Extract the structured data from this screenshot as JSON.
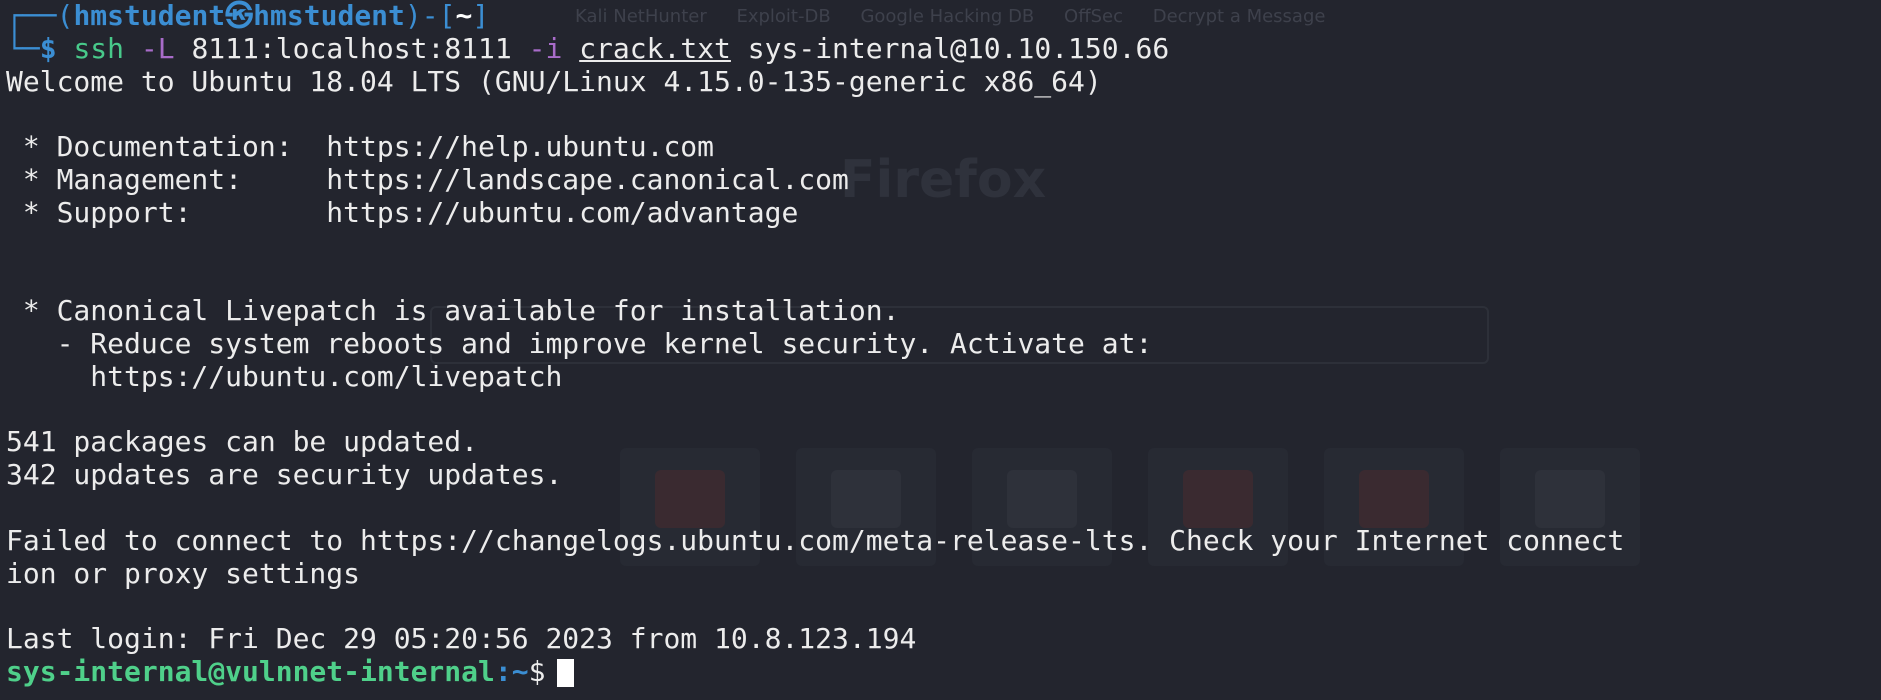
{
  "prompt": {
    "corner_top": "┌──(",
    "user": "hmstudent",
    "at_symbol": "㉿",
    "host": "hmstudent",
    "mid": ")-[",
    "dir": "~",
    "close": "]",
    "corner_bottom": "└─",
    "dollar": "$"
  },
  "command": {
    "program": "ssh",
    "flag1": "-L",
    "tunnel": "8111:localhost:8111",
    "flag2": "-i",
    "keyfile": "crack.txt",
    "target": "sys-internal@10.10.150.66"
  },
  "output": {
    "welcome": "Welcome to Ubuntu 18.04 LTS (GNU/Linux 4.15.0-135-generic x86_64)",
    "doc": " * Documentation:  https://help.ubuntu.com",
    "mgmt": " * Management:     https://landscape.canonical.com",
    "support": " * Support:        https://ubuntu.com/advantage",
    "livepatch": " * Canonical Livepatch is available for installation.",
    "reduce": "   - Reduce system reboots and improve kernel security. Activate at:",
    "livepatch_url": "     https://ubuntu.com/livepatch",
    "packages": "541 packages can be updated.",
    "security": "342 updates are security updates.",
    "failed_1": "Failed to connect to https://changelogs.ubuntu.com/meta-release-lts. Check your Internet connect",
    "failed_2": "ion or proxy settings",
    "last_login": "Last login: Fri Dec 29 05:20:56 2023 from 10.8.123.194"
  },
  "remote_prompt": {
    "userhost": "sys-internal@vulnnet-internal",
    "colon": ":",
    "path": "~",
    "dollar": "$"
  },
  "ghost": {
    "bookmarks": [
      "Kali NetHunter",
      "Exploit-DB",
      "Google Hacking DB",
      "OffSec",
      "Decrypt a Message"
    ],
    "logo": "Firefox"
  },
  "colors": {
    "background": "#23252e",
    "prompt_blue": "#3b8ed3",
    "command_green": "#48c98a",
    "flag_purple": "#a86cc9",
    "remote_user_green": "#4fd08a"
  }
}
